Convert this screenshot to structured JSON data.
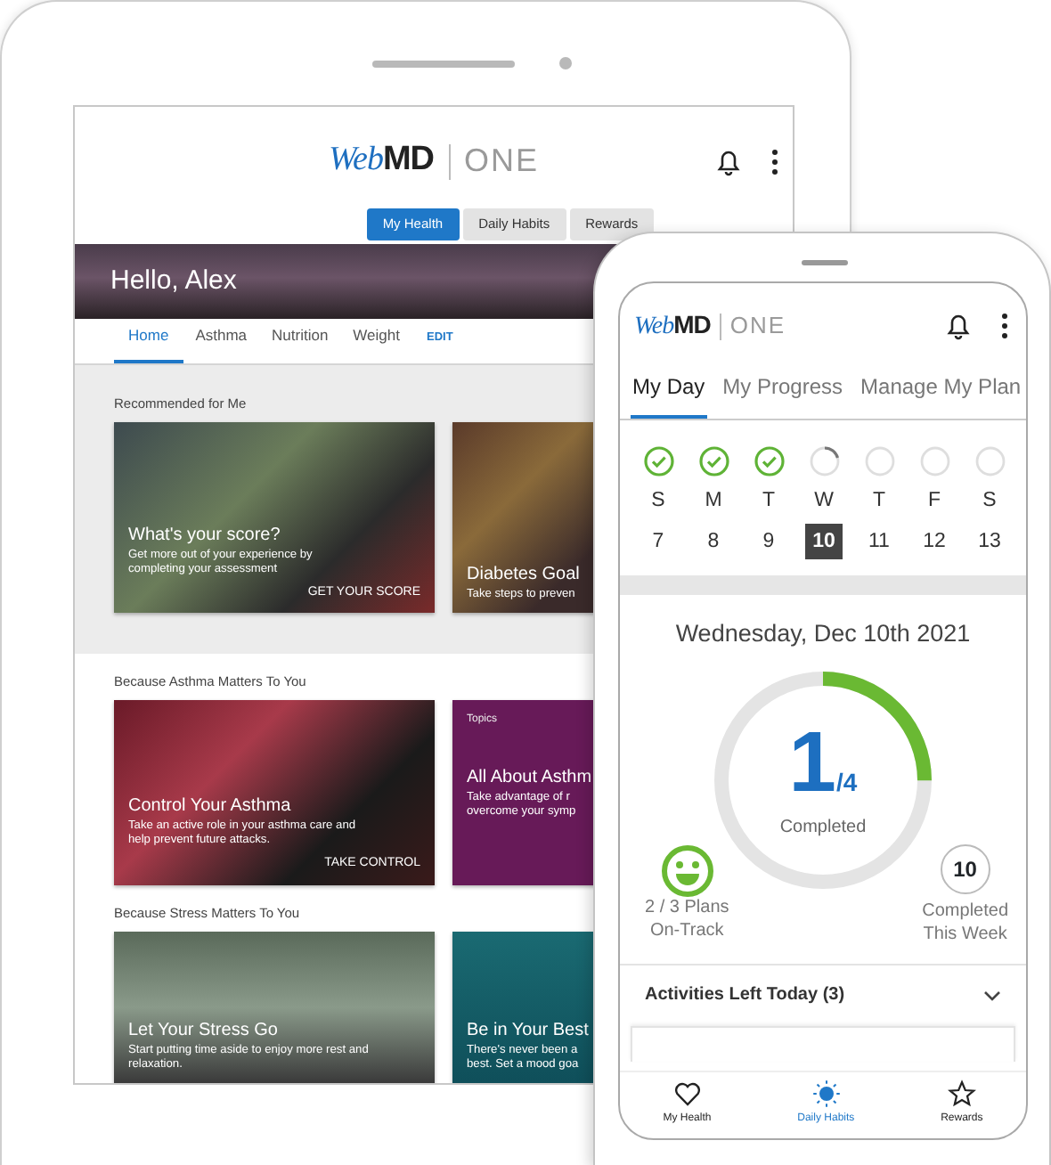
{
  "tablet": {
    "logo": {
      "brand_first": "Web",
      "brand_second": "MD",
      "product": "ONE"
    },
    "segments": [
      {
        "label": "My Health",
        "selected": true
      },
      {
        "label": "Daily Habits",
        "selected": false
      },
      {
        "label": "Rewards",
        "selected": false
      }
    ],
    "greeting": "Hello, Alex",
    "tabs": [
      {
        "label": "Home",
        "selected": true
      },
      {
        "label": "Asthma",
        "selected": false
      },
      {
        "label": "Nutrition",
        "selected": false
      },
      {
        "label": "Weight",
        "selected": false
      }
    ],
    "edit_link": "EDIT",
    "sections": [
      {
        "heading": "Recommended for Me",
        "shaded": true,
        "cards": [
          {
            "kind": "photo",
            "title": "What's your score?",
            "lines": [
              "Get more out of your experience by",
              "completing your assessment"
            ],
            "action": "GET YOUR SCORE"
          },
          {
            "kind": "photo",
            "title": "Diabetes Goal",
            "lines": [
              "Take steps to preven"
            ]
          }
        ]
      },
      {
        "heading": "Because Asthma Matters To You",
        "shaded": false,
        "cards": [
          {
            "kind": "photo",
            "title": "Control Your Asthma",
            "lines": [
              "Take an active role in your asthma care and",
              "help prevent future attacks."
            ],
            "action": "TAKE CONTROL"
          },
          {
            "kind": "topic",
            "label": "Topics",
            "title": "All About Asthm",
            "lines": [
              "Take advantage of r",
              "overcome your symp"
            ]
          }
        ]
      },
      {
        "heading": "Because Stress Matters To You",
        "shaded": false,
        "cards": [
          {
            "kind": "photo",
            "title": "Let Your Stress Go",
            "lines": [
              "Start putting time aside to enjoy more rest and",
              "relaxation."
            ]
          },
          {
            "kind": "photo",
            "title": "Be in Your Best",
            "lines": [
              "There's never been a",
              "best. Set a mood goa"
            ]
          }
        ]
      }
    ]
  },
  "phone": {
    "logo": {
      "brand_first": "Web",
      "brand_second": "MD",
      "product": "ONE"
    },
    "tabs": [
      {
        "label": "My Day",
        "selected": true
      },
      {
        "label": "My Progress",
        "selected": false
      },
      {
        "label": "Manage My Plan",
        "selected": false
      }
    ],
    "week": [
      {
        "day": "S",
        "date": "7",
        "kind": "done",
        "selected": false
      },
      {
        "day": "M",
        "date": "8",
        "kind": "done",
        "selected": false
      },
      {
        "day": "T",
        "date": "9",
        "kind": "done",
        "selected": false
      },
      {
        "day": "W",
        "date": "10",
        "kind": "progress",
        "selected": true
      },
      {
        "day": "T",
        "date": "11",
        "kind": "none",
        "selected": false
      },
      {
        "day": "F",
        "date": "12",
        "kind": "none",
        "selected": false
      },
      {
        "day": "S",
        "date": "13",
        "kind": "none",
        "selected": false
      }
    ],
    "date_title": "Wednesday, Dec 10th 2021",
    "progress": {
      "count": "1",
      "total": "/4",
      "caption": "Completed",
      "level": 0.25
    },
    "plans": {
      "lines": [
        "2 / 3 Plans",
        "On-Track"
      ]
    },
    "week_total": {
      "count": "10",
      "lines": [
        "Completed",
        "This Week"
      ]
    },
    "activities": {
      "label": "Activities Left Today (3)"
    },
    "nav": [
      {
        "label": "My Health",
        "kind": "heart",
        "selected": false
      },
      {
        "label": "Daily Habits",
        "kind": "sun",
        "selected": true
      },
      {
        "label": "Rewards",
        "kind": "star",
        "selected": false
      }
    ]
  }
}
